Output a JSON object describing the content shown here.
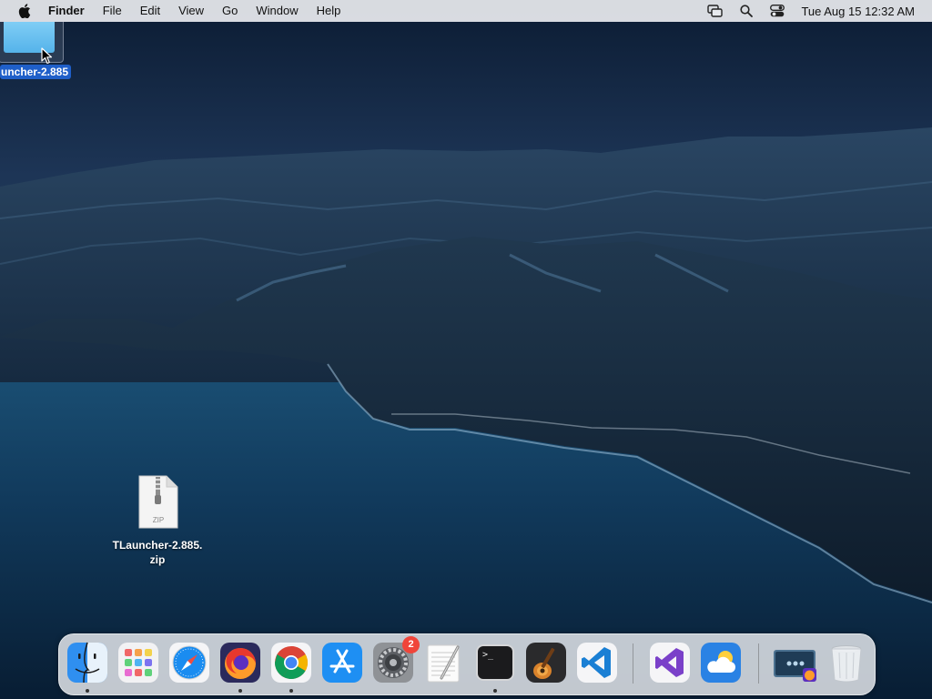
{
  "menubar": {
    "app_name": "Finder",
    "menus": [
      "File",
      "Edit",
      "View",
      "Go",
      "Window",
      "Help"
    ],
    "clock": "Tue Aug 15  12:32 AM",
    "status_icons": [
      "screen-mirroring-icon",
      "spotlight-search-icon",
      "control-center-icon"
    ]
  },
  "desktop": {
    "folder_label": "uncher-2.885",
    "zip_file": {
      "icon_text": "ZIP",
      "label_line1": "TLauncher-2.885.",
      "label_line2": "zip"
    }
  },
  "dock": {
    "apps": [
      {
        "name": "Finder",
        "icon": "finder-icon",
        "running": true
      },
      {
        "name": "Launchpad",
        "icon": "launchpad-icon",
        "running": false
      },
      {
        "name": "Safari",
        "icon": "safari-icon",
        "running": false
      },
      {
        "name": "Firefox",
        "icon": "firefox-icon",
        "running": true
      },
      {
        "name": "Google Chrome",
        "icon": "chrome-icon",
        "running": true
      },
      {
        "name": "App Store",
        "icon": "app-store-icon",
        "running": false
      },
      {
        "name": "System Preferences",
        "icon": "system-preferences-icon",
        "running": false,
        "badge": "2"
      },
      {
        "name": "TextEdit",
        "icon": "textedit-icon",
        "running": false
      },
      {
        "name": "Terminal",
        "icon": "terminal-icon",
        "running": true
      },
      {
        "name": "GarageBand",
        "icon": "garageband-icon",
        "running": false
      },
      {
        "name": "Visual Studio Code",
        "icon": "vscode-icon",
        "running": false
      },
      {
        "name": "Visual Studio",
        "icon": "visual-studio-icon",
        "running": false
      },
      {
        "name": "Weather",
        "icon": "weather-icon",
        "running": false
      },
      {
        "name": "Firefox Downloads",
        "icon": "downloads-stack-icon",
        "running": false
      },
      {
        "name": "Trash",
        "icon": "trash-icon",
        "running": false
      }
    ],
    "terminal_prompt": ">_"
  }
}
